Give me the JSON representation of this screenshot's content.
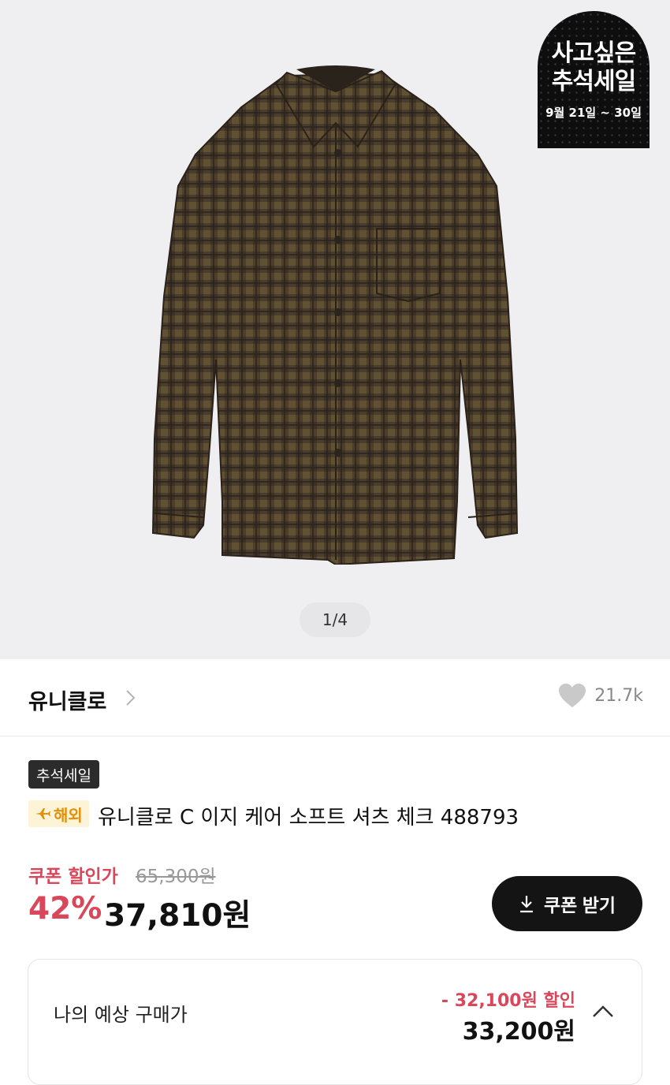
{
  "hero": {
    "pager": "1/4",
    "promo_badge": {
      "line1": "사고싶은",
      "line2": "추석세일",
      "dates": "9월 21일 ~ 30일"
    }
  },
  "brand": {
    "name": "유니클로",
    "likes": "21.7k"
  },
  "product": {
    "tag": "추석세일",
    "overseas_badge": "해외",
    "title": "유니클로 C 이지 케어 소프트 셔츠 체크 488793"
  },
  "pricing": {
    "coupon_label": "쿠폰 할인가",
    "original_price": "65,300원",
    "discount_rate": "42%",
    "sale_price": "37,810원",
    "coupon_button": "쿠폰 받기"
  },
  "estimate": {
    "label": "나의 예상 구매가",
    "savings": "- 32,100원 할인",
    "final_price": "33,200원"
  },
  "colors": {
    "accent_red": "#d9475a",
    "button_dark": "#141414",
    "overseas_orange": "#e0900a"
  }
}
